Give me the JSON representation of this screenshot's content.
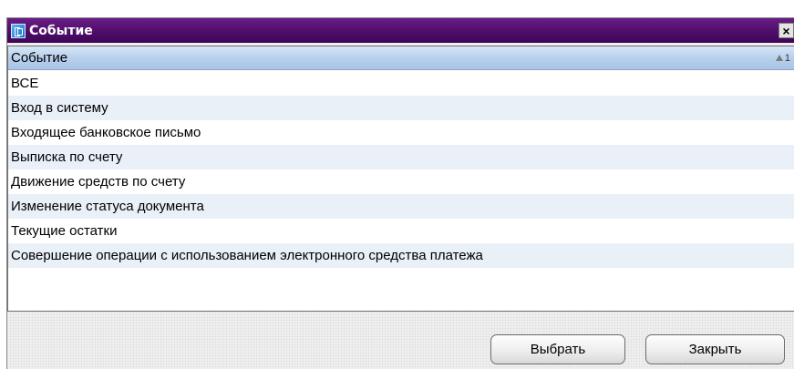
{
  "window": {
    "title": "Событие",
    "close_glyph": "×",
    "icon": "app-icon"
  },
  "table": {
    "column_header": "Событие",
    "sort_indicator": "1",
    "rows": [
      "ВСЕ",
      "Вход в систему",
      "Входящее банковское письмо",
      "Выписка по счету",
      "Движение средств по счету",
      "Изменение статуса документа",
      "Текущие остатки",
      "Совершение операции с использованием электронного средства платежа"
    ]
  },
  "buttons": {
    "select_label": "Выбрать",
    "close_label": "Закрыть"
  },
  "colors": {
    "titlebar": "#4f0d6a",
    "header": "#b8d0ec",
    "alt_row": "#e9f0f8"
  }
}
